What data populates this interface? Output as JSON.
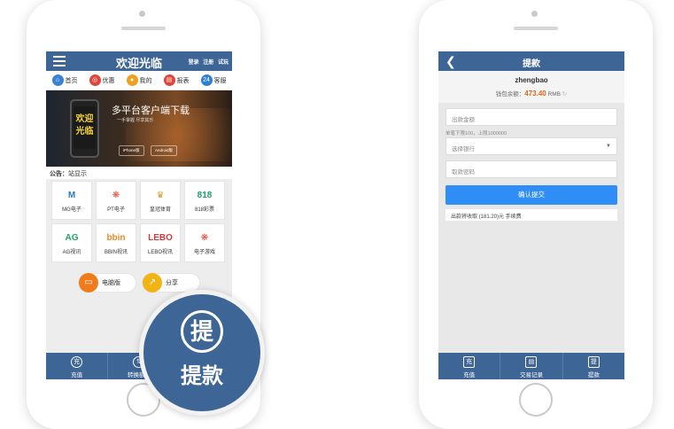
{
  "left": {
    "header": {
      "title": "欢迎光临",
      "links": [
        "登录",
        "注册",
        "试玩"
      ]
    },
    "nav": [
      {
        "label": "首页",
        "icon": "home-icon",
        "color": "#3b82d6",
        "glyph": "⌂"
      },
      {
        "label": "优惠",
        "icon": "gift-icon",
        "color": "#e0443a",
        "glyph": "◎"
      },
      {
        "label": "我的",
        "icon": "user-icon",
        "color": "#f0a020",
        "glyph": "●"
      },
      {
        "label": "报表",
        "icon": "report-icon",
        "color": "#e0443a",
        "glyph": "▤"
      },
      {
        "label": "客服",
        "icon": "service-icon",
        "color": "#2f7fd6",
        "glyph": "24"
      }
    ],
    "banner": {
      "phone_text": "欢迎光临",
      "headline": "多平台客户端下载",
      "sub": "一手掌握 尽享其乐",
      "stores": [
        "iPhone版",
        "Android版"
      ]
    },
    "notice": {
      "label": "公告：",
      "text": "站显示"
    },
    "games": [
      {
        "label": "MG电子",
        "logo": "M",
        "color": "#2a77c9"
      },
      {
        "label": "PT电子",
        "logo": "❋",
        "color": "#e04334"
      },
      {
        "label": "皇冠体育",
        "logo": "♛",
        "color": "#d59a2a"
      },
      {
        "label": "818彩票",
        "logo": "818",
        "color": "#1e9e6a"
      },
      {
        "label": "AG视讯",
        "logo": "AG",
        "color": "#22a35f"
      },
      {
        "label": "BBIN视讯",
        "logo": "bbin",
        "color": "#e88a2a"
      },
      {
        "label": "LEBO视讯",
        "logo": "LEBO",
        "color": "#d83a3a"
      },
      {
        "label": "电子游戏",
        "logo": "❋",
        "color": "#e04334"
      }
    ],
    "buttons": [
      {
        "label": "电脑版",
        "icon": "computer-icon",
        "color": "#f07b1a",
        "glyph": "▭"
      },
      {
        "label": "分享",
        "icon": "share-icon",
        "color": "#f3b315",
        "glyph": "↗"
      }
    ],
    "tabs": [
      {
        "label": "充值",
        "icon": "recharge-icon",
        "glyph": "充"
      },
      {
        "label": "转换额度",
        "icon": "transfer-icon",
        "glyph": "⇅"
      },
      {
        "label": "",
        "icon": "",
        "glyph": ""
      }
    ],
    "zoom": {
      "glyph": "提",
      "label": "提款"
    }
  },
  "right": {
    "header": {
      "back": "❮",
      "title": "提款"
    },
    "user": {
      "name": "zhengbao",
      "balance_label": "钱包余额：",
      "balance": "473.40",
      "unit": "RMB"
    },
    "form": {
      "amount_placeholder": "出款金额",
      "limit_hint": "单笔下限100，上限1000000",
      "bank_placeholder": "选择银行",
      "password_placeholder": "取款密码",
      "submit_label": "确认提交",
      "fee_text": "出款将收取 (181.20)元 手续费"
    },
    "tabs": [
      {
        "label": "充值",
        "icon": "recharge-icon",
        "glyph": "充"
      },
      {
        "label": "交易记录",
        "icon": "record-icon",
        "glyph": "▤"
      },
      {
        "label": "提款",
        "icon": "withdraw-icon",
        "glyph": "提"
      }
    ]
  }
}
